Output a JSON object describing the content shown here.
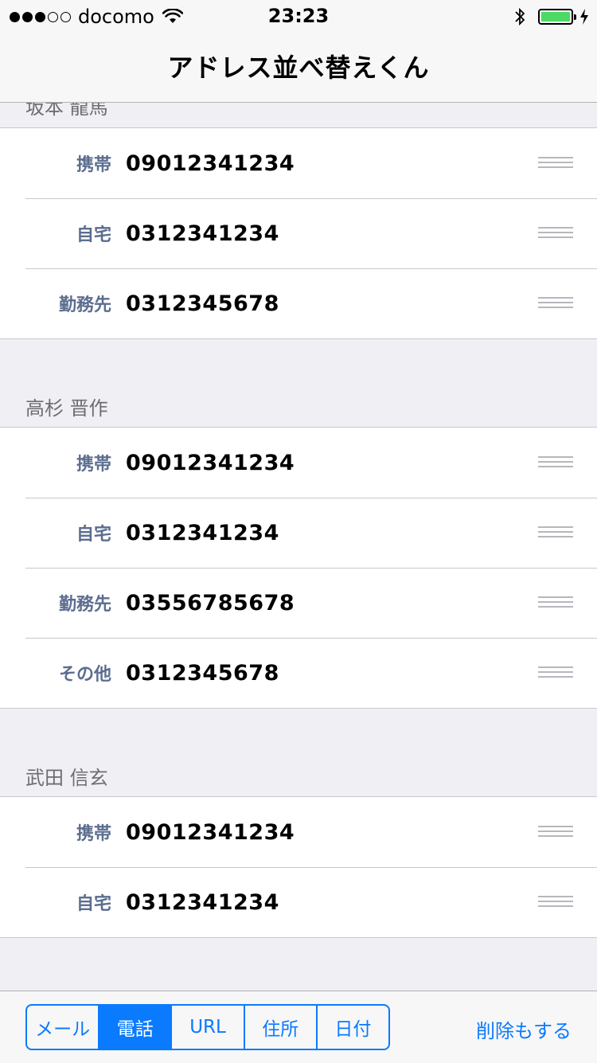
{
  "status_bar": {
    "signal_filled": 3,
    "signal_empty": 2,
    "carrier": "docomo",
    "time": "23:23",
    "icons": [
      "wifi-icon",
      "bluetooth-icon",
      "battery-icon",
      "charging-bolt-icon"
    ]
  },
  "nav": {
    "title": "アドレス並べ替えくん"
  },
  "sections": [
    {
      "header": "坂本 龍馬",
      "rows": [
        {
          "label": "携帯",
          "value": "09012341234"
        },
        {
          "label": "自宅",
          "value": "0312341234"
        },
        {
          "label": "勤務先",
          "value": "0312345678"
        }
      ]
    },
    {
      "header": "高杉 晋作",
      "rows": [
        {
          "label": "携帯",
          "value": "09012341234"
        },
        {
          "label": "自宅",
          "value": "0312341234"
        },
        {
          "label": "勤務先",
          "value": "03556785678"
        },
        {
          "label": "その他",
          "value": "0312345678"
        }
      ]
    },
    {
      "header": "武田 信玄",
      "rows": [
        {
          "label": "携帯",
          "value": "09012341234"
        },
        {
          "label": "自宅",
          "value": "0312341234"
        }
      ]
    }
  ],
  "toolbar": {
    "segments": [
      "メール",
      "電話",
      "URL",
      "住所",
      "日付"
    ],
    "selected_segment": "電話",
    "action_label": "削除もする"
  },
  "colors": {
    "accent": "#0a7aff",
    "label": "#5c6e8f",
    "battery": "#4cd964"
  }
}
